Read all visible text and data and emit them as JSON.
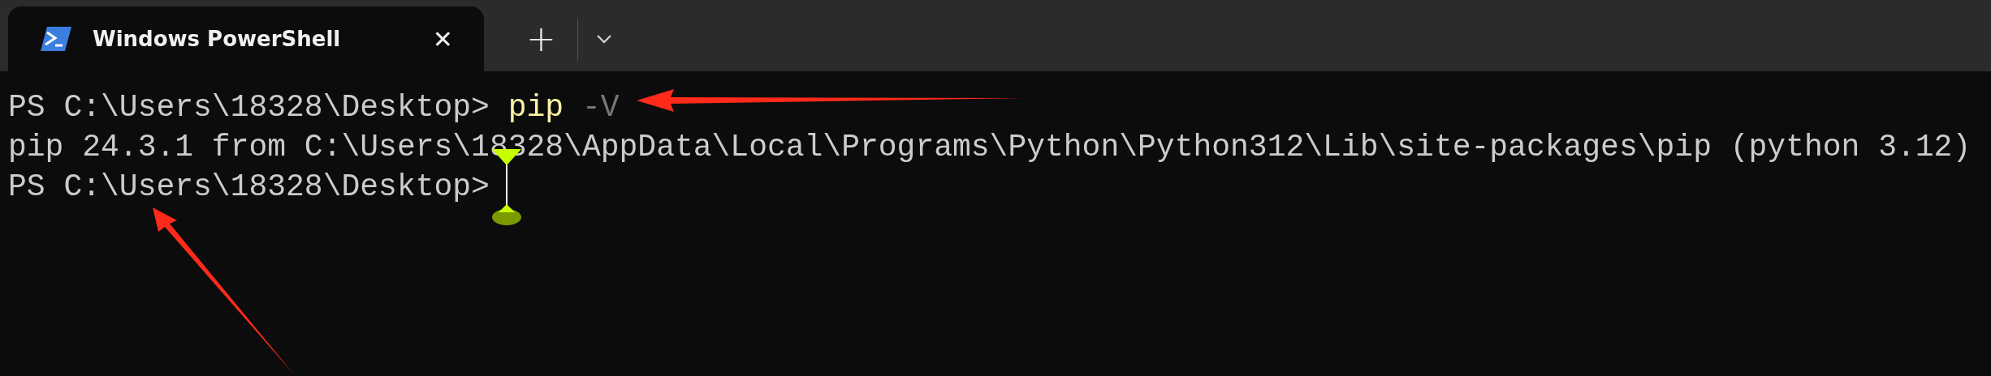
{
  "tabs": [
    {
      "title": "Windows PowerShell",
      "selected": true,
      "close": "✕"
    }
  ],
  "new_tab": "+",
  "terminal": {
    "lines": [
      [
        {
          "kind": "prompt",
          "text": "PS C:\\Users\\18328\\Desktop> "
        },
        {
          "kind": "command",
          "text": "pip"
        },
        {
          "kind": "param",
          "text": "-V"
        }
      ],
      [
        {
          "kind": "plain",
          "text": "pip 24.3.1 from C:\\Users\\18328\\AppData\\Local\\Programs\\Python\\Python312\\Lib\\site-packages\\pip (python 3.12)"
        }
      ],
      [
        {
          "kind": "prompt",
          "text": "PS C:\\Users\\18328\\Desktop>"
        }
      ]
    ]
  }
}
